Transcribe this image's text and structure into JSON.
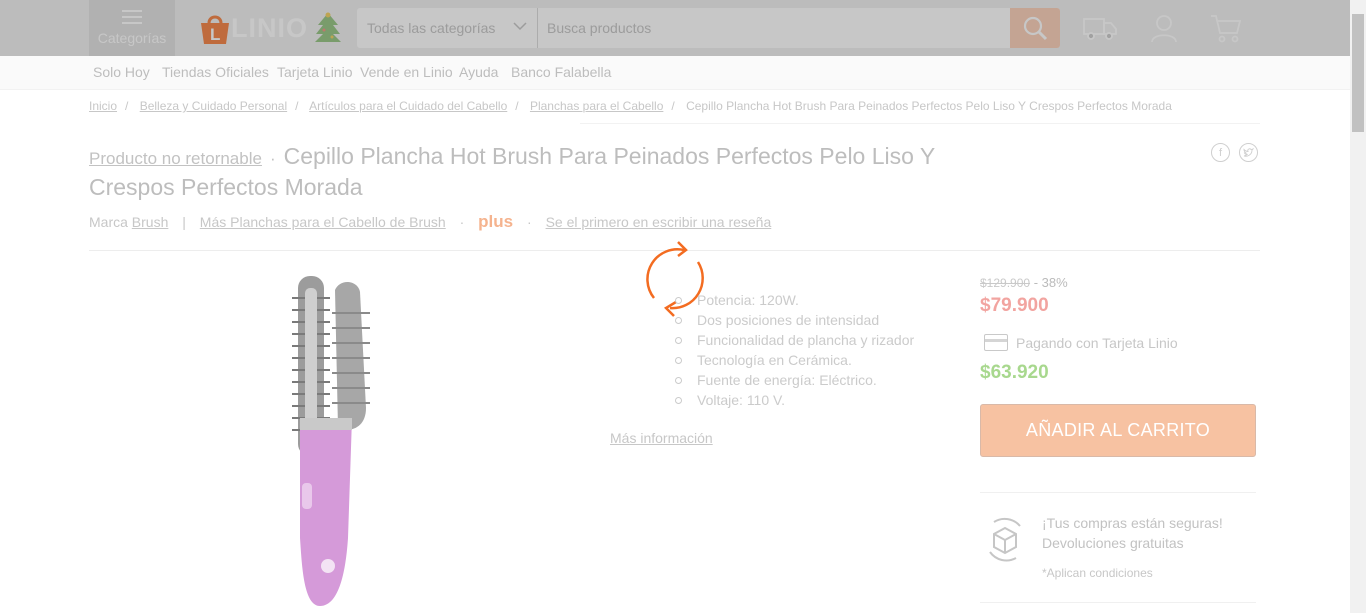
{
  "header": {
    "categories_label": "Categorías",
    "logo_text": "LINIO",
    "search": {
      "category_value": "Todas las categorías",
      "placeholder": "Busca productos"
    }
  },
  "subnav": [
    "Solo Hoy",
    "Tiendas Oficiales",
    "Tarjeta Linio",
    "Vende en Linio",
    "Ayuda",
    "Banco Falabella"
  ],
  "breadcrumb": {
    "items": [
      "Inicio",
      "Belleza y Cuidado Personal",
      "Artículos para el Cuidado del Cabello",
      "Planchas para el Cabello"
    ],
    "current": "Cepillo Plancha Hot Brush Para Peinados Perfectos Pelo Liso Y Crespos Perfectos Morada"
  },
  "product": {
    "non_returnable": "Producto no retornable",
    "title": "Cepillo Plancha Hot Brush Para Peinados Perfectos Pelo Liso Y Crespos Perfectos Morada",
    "brand_prefix": "Marca",
    "brand": "Brush",
    "more_link": "Más Planchas para el Cabello de Brush",
    "plus": "plus",
    "review_link": "Se el primero en escribir una reseña",
    "specs": [
      "Potencia: 120W.",
      "Dos posiciones de intensidad",
      "Funcionalidad de plancha y rizador",
      "Tecnología en Cerámica.",
      "Fuente de energía: Eléctrico.",
      "Voltaje: 110 V."
    ],
    "more_info": "Más información"
  },
  "pricing": {
    "old_price": "$129.900",
    "discount": "- 38%",
    "price": "$79.900",
    "card_label": "Pagando con Tarjeta Linio",
    "card_price": "$63.920",
    "add_to_cart": "AÑADIR AL CARRITO",
    "safe_line1": "¡Tus compras están seguras!",
    "safe_line2": "Devoluciones gratuitas",
    "conditions": "*Aplican condiciones"
  },
  "colors": {
    "brand_orange": "#f36c21",
    "price_red": "#e53935",
    "price_green": "#5cb130"
  }
}
